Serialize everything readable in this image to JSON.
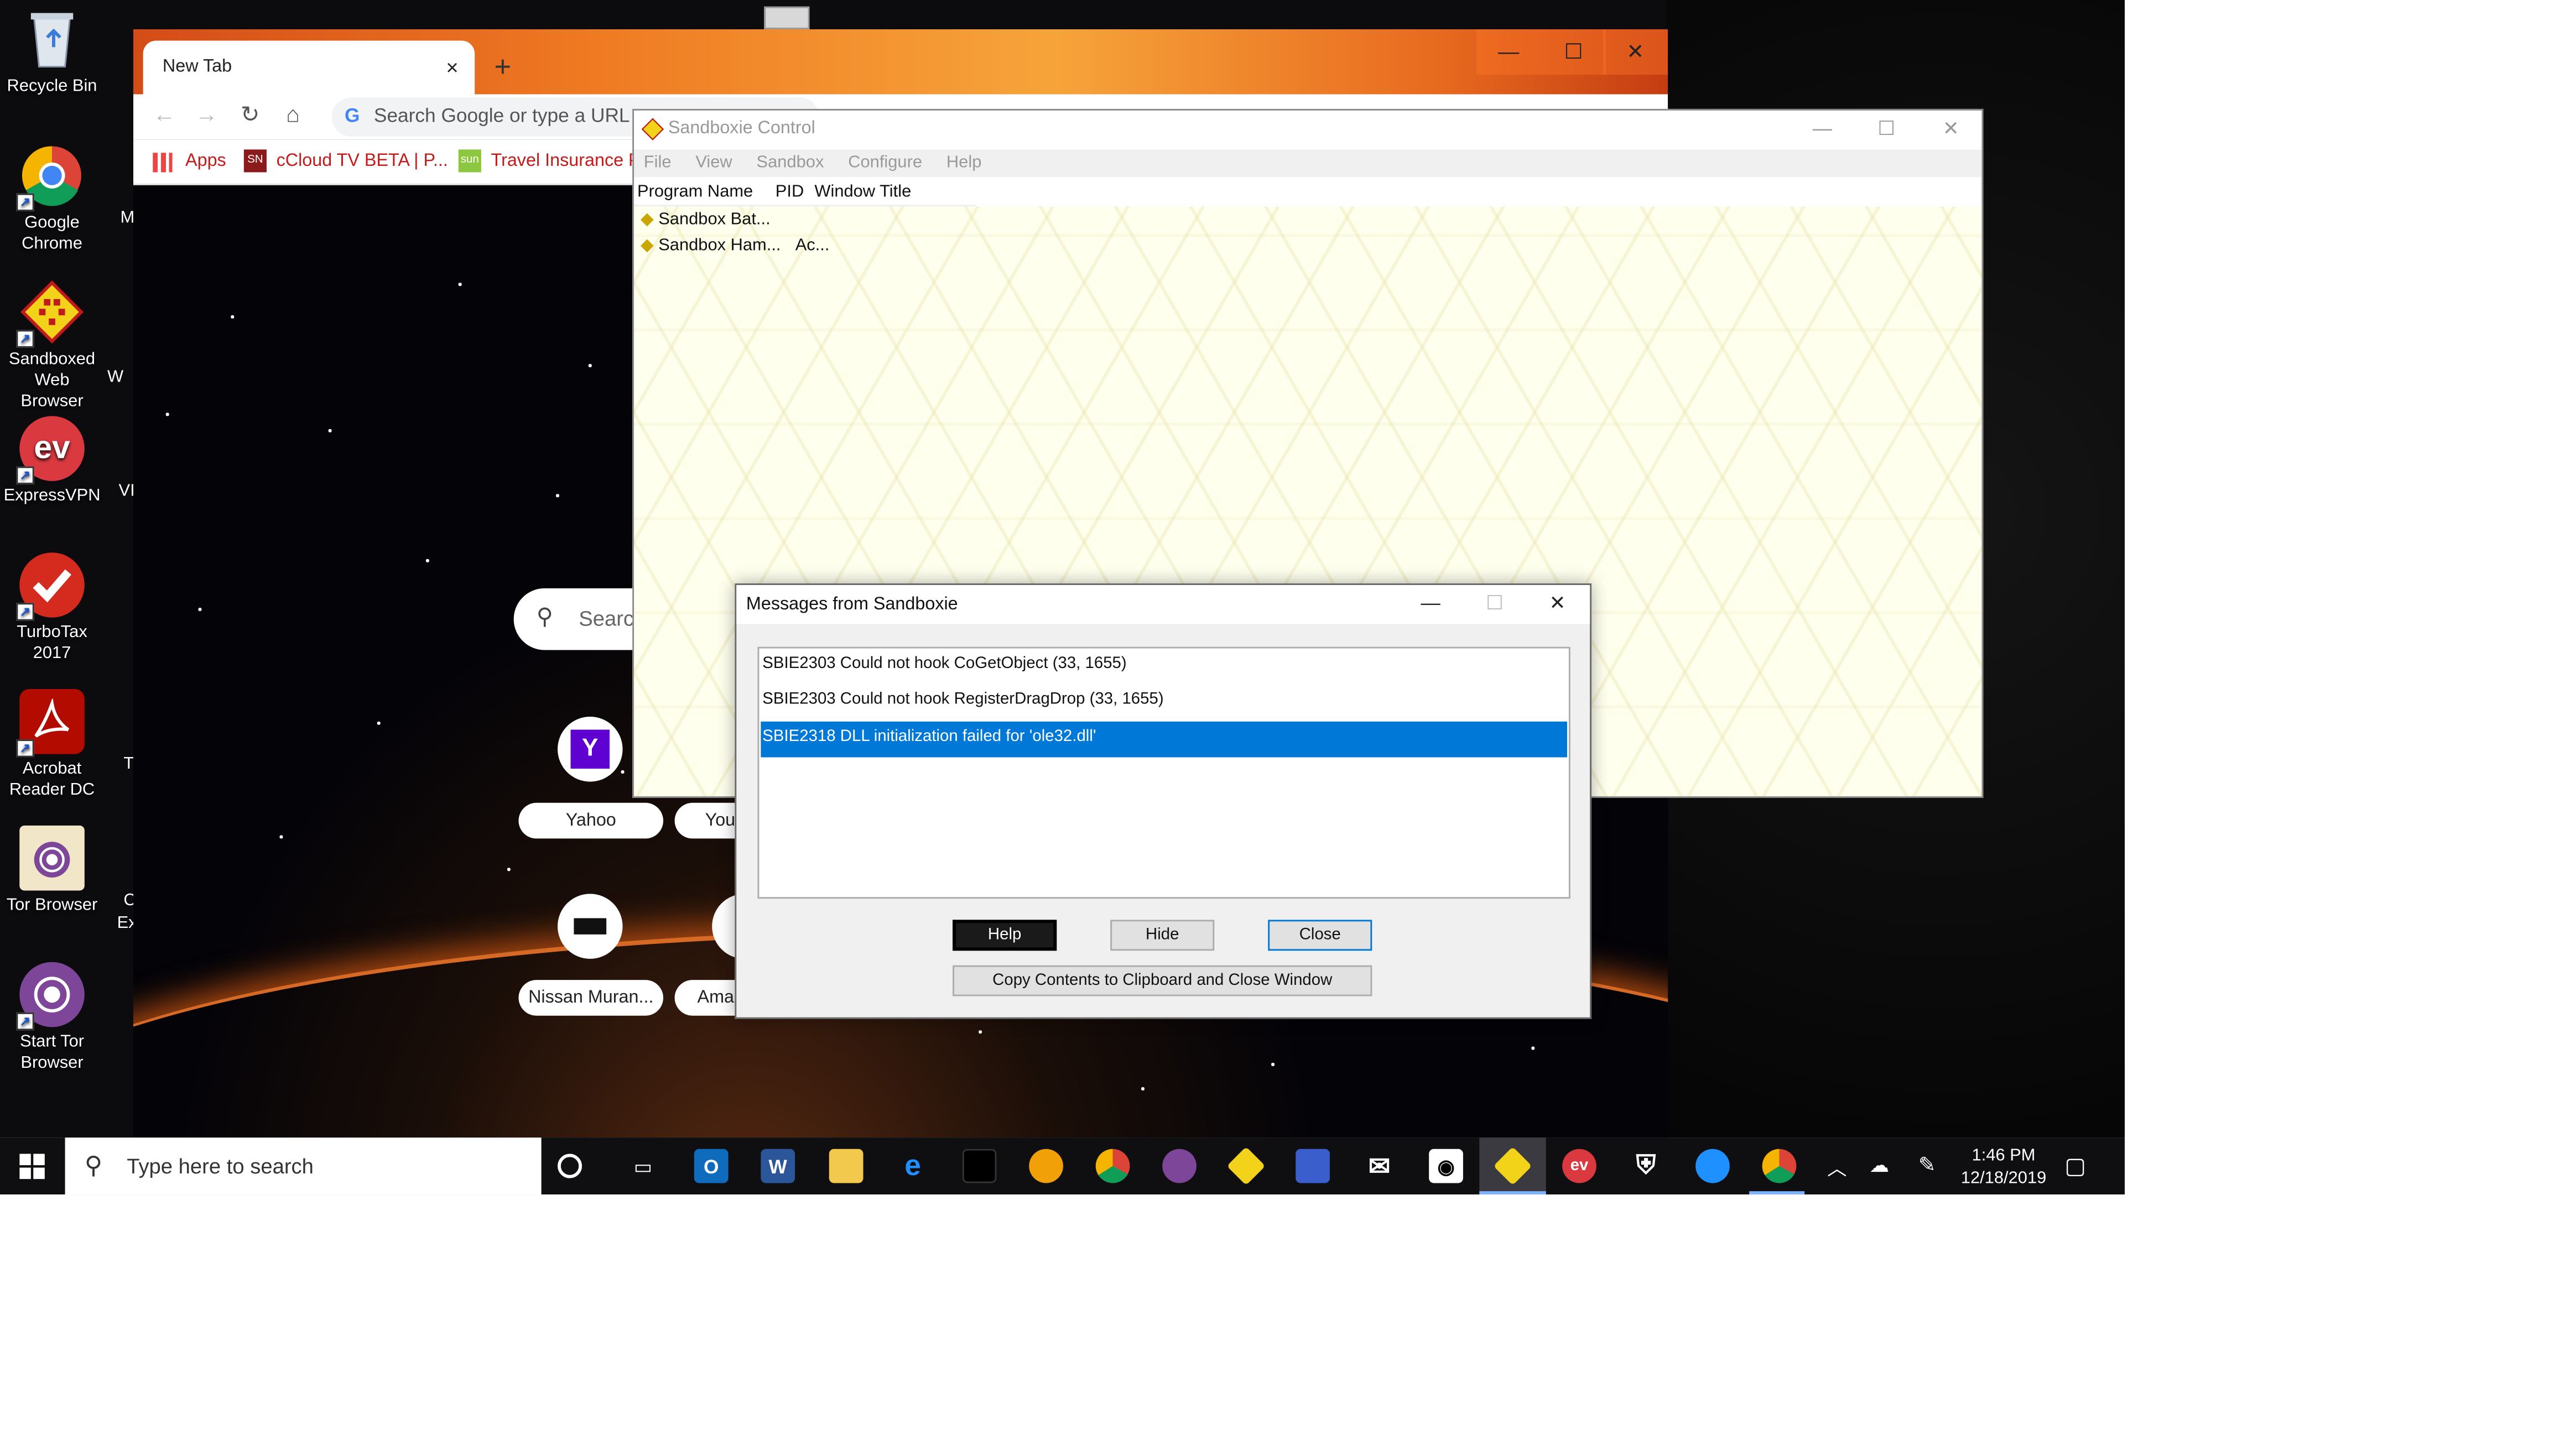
{
  "desktop": {
    "icons": [
      {
        "label": "Recycle Bin",
        "color": "#9aa7b8"
      },
      {
        "label": "Google Chrome",
        "color": "#1a73e8"
      },
      {
        "label": "Sandboxed Web Browser",
        "color": "#e4c319"
      },
      {
        "label": "ExpressVPN",
        "color": "#da3940"
      },
      {
        "label": "TurboTax 2017",
        "color": "#d52b1e"
      },
      {
        "label": "Acrobat Reader DC",
        "color": "#b30b00"
      },
      {
        "label": "Tor Browser",
        "color": "#7d4698"
      },
      {
        "label": "Start Tor Browser",
        "color": "#7d4698"
      }
    ],
    "partial_labels": [
      "M",
      "W",
      "VI",
      "T",
      "Cl",
      "Ex"
    ]
  },
  "chrome": {
    "tab_title": "New Tab",
    "tab_close": "×",
    "new_tab": "+",
    "omnibox_placeholder": "Search Google or type a URL",
    "bookmarks": {
      "apps": "Apps",
      "b1": "cCloud TV BETA | P...",
      "b2": "Travel Insurance Pla"
    },
    "ntp_search_placeholder": "Searc",
    "shortcuts": [
      {
        "label": "Yahoo"
      },
      {
        "label": "You"
      },
      {
        "label": "Nissan Muran..."
      },
      {
        "label": "Amaz"
      }
    ]
  },
  "sandboxie_control": {
    "title": "Sandboxie Control",
    "menu": [
      "File",
      "View",
      "Sandbox",
      "Configure",
      "Help"
    ],
    "columns": [
      "Program Name",
      "PID",
      "Window Title"
    ],
    "rows": [
      {
        "name": "Sandbox Bat...",
        "pid": "",
        "title": ""
      },
      {
        "name": "Sandbox Ham...",
        "pid": "Ac...",
        "title": ""
      }
    ]
  },
  "messages_dialog": {
    "title": "Messages from Sandboxie",
    "messages": [
      "SBIE2303 Could not hook CoGetObject (33, 1655)",
      "SBIE2303 Could not hook RegisterDragDrop (33, 1655)",
      "SBIE2318 DLL initialization failed for 'ole32.dll'"
    ],
    "selected_index": 2,
    "buttons": {
      "help": "Help",
      "hide": "Hide",
      "close": "Close",
      "copy": "Copy Contents to Clipboard and Close Window"
    }
  },
  "taskbar": {
    "search_placeholder": "Type here to search",
    "time": "1:46 PM",
    "date": "12/18/2019"
  }
}
